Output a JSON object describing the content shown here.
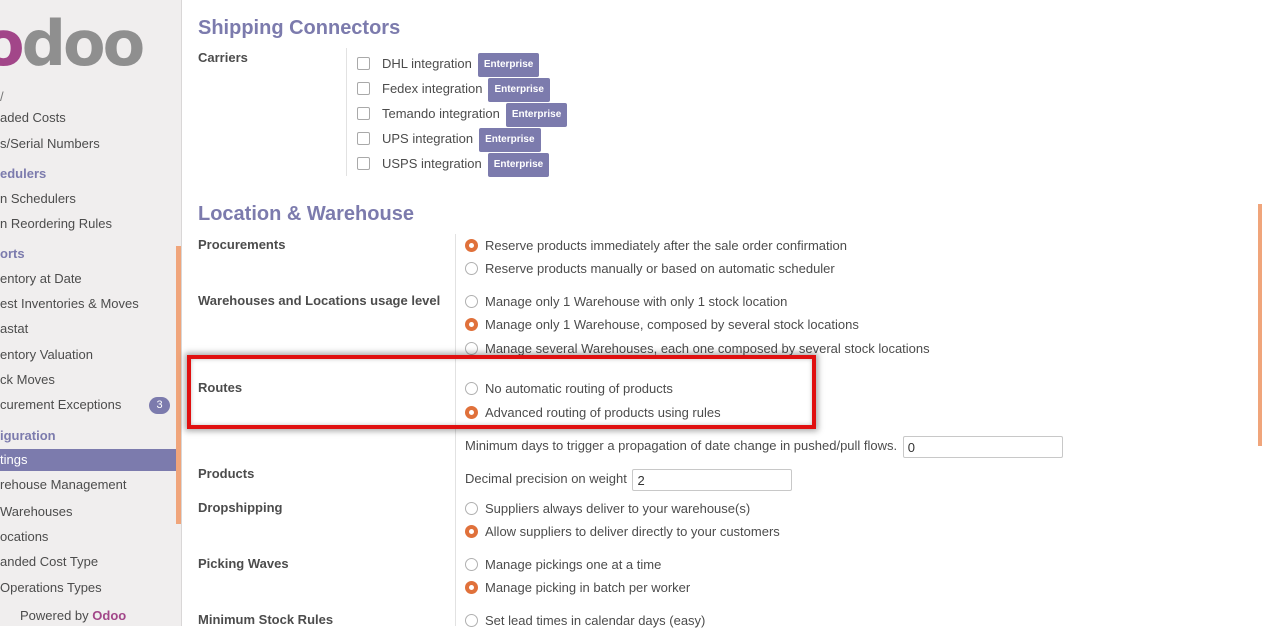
{
  "sidebar": {
    "logo": {
      "first": "o",
      "rest": "doo"
    },
    "stub": "/",
    "items": [
      {
        "label": "aded Costs",
        "kind": "item"
      },
      {
        "label": "s/Serial Numbers",
        "kind": "item"
      },
      {
        "label": "edulers",
        "kind": "head"
      },
      {
        "label": "n Schedulers",
        "kind": "item"
      },
      {
        "label": "n Reordering Rules",
        "kind": "item"
      },
      {
        "label": "orts",
        "kind": "head"
      },
      {
        "label": "entory at Date",
        "kind": "item"
      },
      {
        "label": "est Inventories & Moves",
        "kind": "item"
      },
      {
        "label": "astat",
        "kind": "item"
      },
      {
        "label": "entory Valuation",
        "kind": "item"
      },
      {
        "label": "ck Moves",
        "kind": "item"
      },
      {
        "label": "curement Exceptions",
        "kind": "item"
      },
      {
        "label": "iguration",
        "kind": "head"
      },
      {
        "label": "tings",
        "kind": "active"
      },
      {
        "label": "rehouse Management",
        "kind": "item"
      },
      {
        "label": "Warehouses",
        "kind": "item"
      },
      {
        "label": "ocations",
        "kind": "item"
      },
      {
        "label": "anded Cost Type",
        "kind": "item"
      },
      {
        "label": "Operations Types",
        "kind": "item"
      }
    ],
    "exceptions_badge": "3",
    "powered_prefix": "Powered by",
    "powered_brand": "Odoo"
  },
  "shipping": {
    "title": "Shipping Connectors",
    "carriers_label": "Carriers",
    "badge": "Enterprise",
    "carriers": [
      {
        "label": "DHL integration",
        "checked": false
      },
      {
        "label": "Fedex integration",
        "checked": false
      },
      {
        "label": "Temando integration",
        "checked": false
      },
      {
        "label": "UPS integration",
        "checked": false
      },
      {
        "label": "USPS integration",
        "checked": false
      }
    ]
  },
  "location": {
    "title": "Location & Warehouse",
    "procurements": {
      "label": "Procurements",
      "options": [
        {
          "label": "Reserve products immediately after the sale order confirmation",
          "selected": true
        },
        {
          "label": "Reserve products manually or based on automatic scheduler",
          "selected": false
        }
      ]
    },
    "usage_level": {
      "label": "Warehouses and Locations usage level",
      "options": [
        {
          "label": "Manage only 1 Warehouse with only 1 stock location",
          "selected": false
        },
        {
          "label": "Manage only 1 Warehouse, composed by several stock locations",
          "selected": true
        },
        {
          "label": "Manage several Warehouses, each one composed by several stock locations",
          "selected": false
        }
      ]
    },
    "routes": {
      "label": "Routes",
      "options": [
        {
          "label": "No automatic routing of products",
          "selected": false
        },
        {
          "label": "Advanced routing of products using rules",
          "selected": true
        }
      ],
      "min_days_label": "Minimum days to trigger a propagation of date change in pushed/pull flows.",
      "min_days_value": "0"
    },
    "products": {
      "label": "Products",
      "decimal_label": "Decimal precision on weight",
      "decimal_value": "2"
    },
    "dropshipping": {
      "label": "Dropshipping",
      "options": [
        {
          "label": "Suppliers always deliver to your warehouse(s)",
          "selected": false
        },
        {
          "label": "Allow suppliers to deliver directly to your customers",
          "selected": true
        }
      ]
    },
    "picking_waves": {
      "label": "Picking Waves",
      "options": [
        {
          "label": "Manage pickings one at a time",
          "selected": false
        },
        {
          "label": "Manage picking in batch per worker",
          "selected": true
        }
      ]
    },
    "min_stock_rules": {
      "label": "Minimum Stock Rules",
      "options": [
        {
          "label": "Set lead times in calendar days (easy)",
          "selected": false
        }
      ]
    }
  },
  "colors": {
    "accent": "#7c7bad",
    "radio_on": "#e0713b",
    "highlight": "#e01010",
    "brand": "#a24689"
  }
}
